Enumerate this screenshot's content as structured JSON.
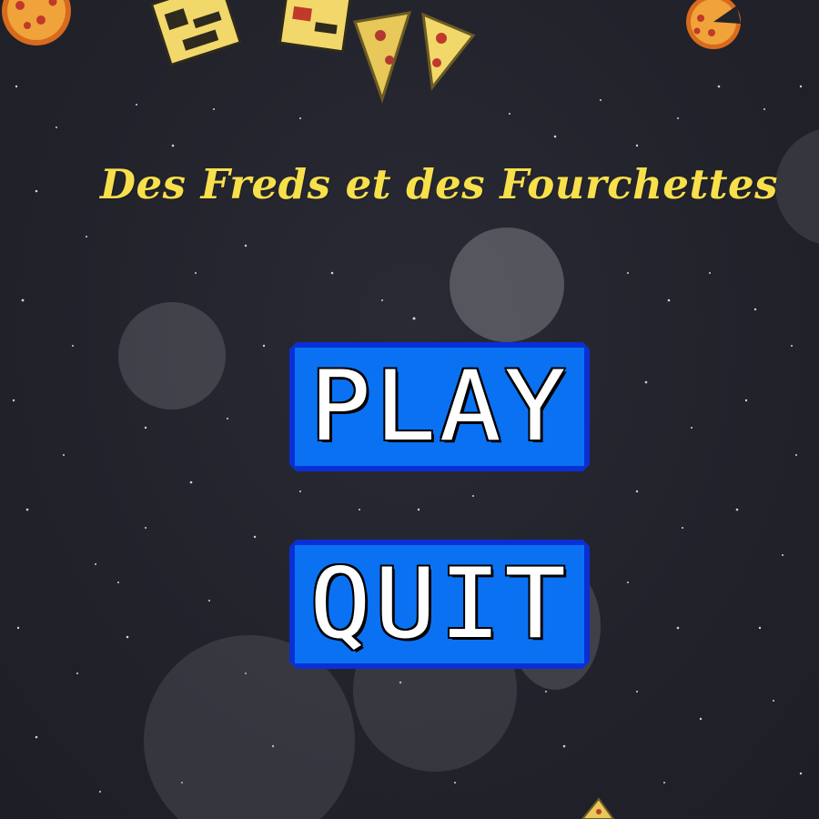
{
  "title": "Des Freds et des Fourchettes",
  "menu": {
    "play_label": "PLAY",
    "quit_label": "QUIT"
  },
  "colors": {
    "title": "#f7e04b",
    "button_fill": "#0a72f2",
    "button_border": "#0a2fd6",
    "button_text": "#ffffff",
    "background": "#23232c"
  },
  "decorations": [
    "pizza-icon",
    "pizza-slice-icon",
    "pizza-box-icon",
    "star-icon",
    "bokeh-circle"
  ]
}
